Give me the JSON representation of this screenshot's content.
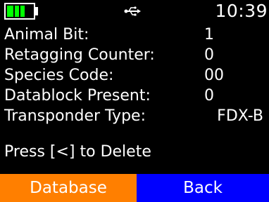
{
  "colors": {
    "background": "#000000",
    "text": "#ffffff",
    "battery": "#00ff00",
    "softkey_left": "#ff7f00",
    "softkey_right": "#0000ff"
  },
  "status": {
    "battery_icon": "battery-icon",
    "battery_level": 0.75,
    "usb_icon": "usb-icon",
    "time": "10:39"
  },
  "rows": [
    {
      "label": "Animal Bit:",
      "value": "1"
    },
    {
      "label": "Retagging Counter:",
      "value": "0"
    },
    {
      "label": "Species Code:",
      "value": "00"
    },
    {
      "label": "Datablock Present:",
      "value": "0"
    },
    {
      "label": "Transponder Type:",
      "value": "FDX-B"
    }
  ],
  "prompt": "Press [<] to Delete",
  "softkeys": {
    "left": "Database",
    "right": "Back"
  }
}
